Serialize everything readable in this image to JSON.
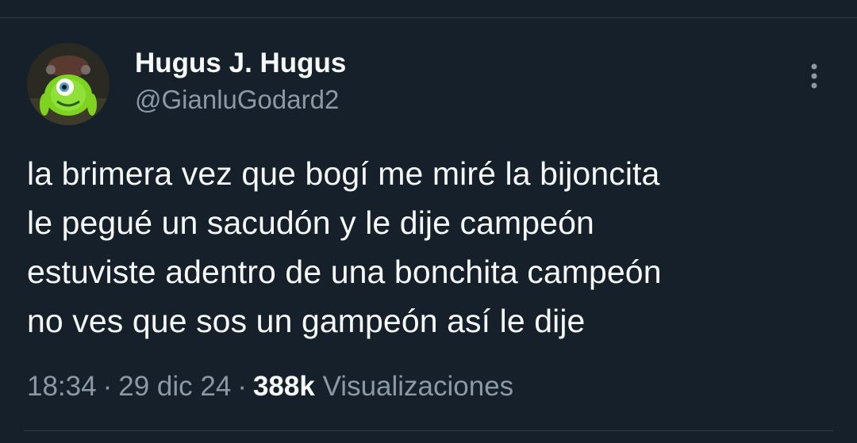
{
  "author": {
    "display_name": "Hugus J. Hugus",
    "handle": "@GianluGodard2"
  },
  "tweet": {
    "text": "la brimera vez que bogí me miré la bijoncita\nle pegué un sacudón y le dije campeón\nestuviste adentro de una bonchita campeón\nno ves que sos un gampeón así le dije"
  },
  "meta": {
    "time": "18:34",
    "date": "29 dic 24",
    "separator": "·",
    "views_count": "388k",
    "views_label": "Visualizaciones"
  },
  "colors": {
    "background": "#15202b",
    "primary_text": "#f7f9f9",
    "secondary_text": "#8b98a5",
    "divider": "#2f3b47"
  },
  "icons": {
    "more": "more-vertical-icon",
    "avatar": "avatar-image"
  }
}
